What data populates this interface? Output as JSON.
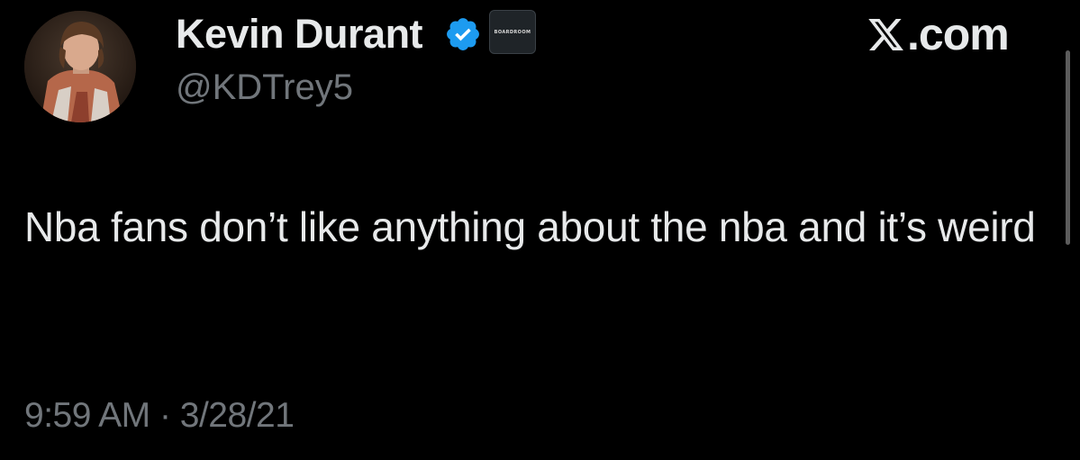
{
  "post": {
    "author": {
      "name": "Kevin Durant",
      "handle": "@KDTrey5",
      "verified_icon": "verified-badge-icon",
      "affiliate_badge_text": "BOARDROOM"
    },
    "text": "Nba fans don’t like anything about the nba and it’s weird",
    "time": "9:59 AM",
    "separator": "·",
    "date": "3/28/21"
  },
  "site": {
    "logo_icon": "x-logo-icon",
    "suffix": ".com"
  },
  "colors": {
    "background": "#000000",
    "primary_text": "#e7e9ea",
    "secondary_text": "#71767b",
    "verified_blue": "#1d9bf0"
  }
}
